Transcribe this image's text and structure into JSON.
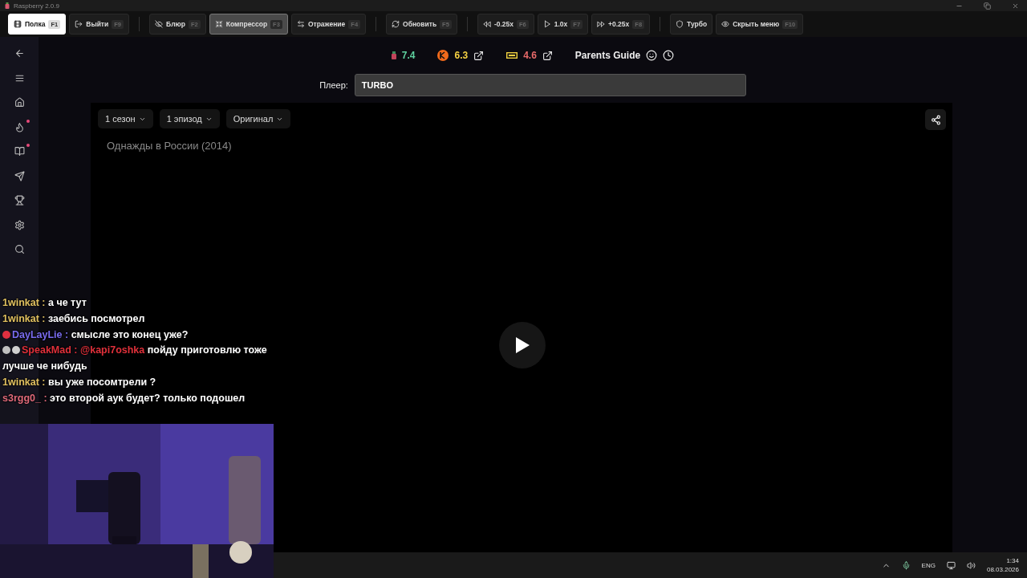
{
  "window": {
    "title": "Raspberry 2.0.9"
  },
  "toolbar": [
    [
      {
        "label": "Полка",
        "key": "F1",
        "selected": true,
        "on": false
      },
      {
        "label": "Выйти",
        "key": "F9",
        "selected": false,
        "on": false
      }
    ],
    [
      {
        "label": "Блюр",
        "key": "F2",
        "selected": false,
        "on": false
      },
      {
        "label": "Компрессор",
        "key": "F3",
        "selected": false,
        "on": true
      },
      {
        "label": "Отражение",
        "key": "F4",
        "selected": false,
        "on": false
      }
    ],
    [
      {
        "label": "Обновить",
        "key": "F5",
        "selected": false,
        "on": false
      }
    ],
    [
      {
        "label": "-0.25x",
        "key": "F6",
        "selected": false,
        "on": false
      },
      {
        "label": "1.0x",
        "key": "F7",
        "selected": false,
        "on": false
      },
      {
        "label": "+0.25x",
        "key": "F8",
        "selected": false,
        "on": false
      }
    ],
    [
      {
        "label": "Турбо",
        "selected": false,
        "on": false
      },
      {
        "label": "Скрыть меню",
        "key": "F10",
        "selected": false,
        "on": false
      }
    ]
  ],
  "sidebar": {
    "items": [
      {
        "dot": false
      },
      {
        "dot": false
      },
      {
        "dot": false
      },
      {
        "dot": true
      },
      {
        "dot": true
      },
      {
        "dot": false
      },
      {
        "dot": false
      },
      {
        "dot": false
      },
      {
        "dot": false
      }
    ]
  },
  "ratings": [
    {
      "value": "7.4",
      "color": "#5fd3a0",
      "link": false
    },
    {
      "value": "6.3",
      "color": "#f5d142",
      "link": true
    },
    {
      "value": "4.6",
      "color": "#e86a6a",
      "link": true
    }
  ],
  "parents_guide": "Parents Guide",
  "player": {
    "label": "Плеер:",
    "value": "TURBO"
  },
  "video": {
    "title": "Однажды в России (2014)",
    "dropdowns": [
      "1 сезон",
      "1 эпизод",
      "Оригинал"
    ]
  },
  "chat": [
    {
      "user": "1winkat",
      "separator": ":",
      "color": "#e0c060",
      "text": "а че тут"
    },
    {
      "user": "1winkat",
      "separator": ":",
      "color": "#e0c060",
      "text": "заебись посмотрел"
    },
    {
      "user": "DayLayLie",
      "separator": ":",
      "color": "#7a6cf0",
      "badges": [
        {
          "color": "#e03040"
        }
      ],
      "text": "смысле это конец уже?"
    },
    {
      "user": "SpeakMad",
      "separator": ":",
      "color": "#e0303a",
      "badges": [
        {
          "color": "#c0c0c0"
        },
        {
          "color": "#d0d0d0"
        }
      ],
      "mention": "@kapi7oshka",
      "text": "пойду приготовлю тоже лучше че нибудь"
    },
    {
      "user": "1winkat",
      "separator": ":",
      "color": "#e0c060",
      "text": "вы уже посомтрели ?"
    },
    {
      "user": "s3rgg0_",
      "separator": ":",
      "color": "#e06a7a",
      "text": "это второй аук будет? только подошел"
    }
  ],
  "webcam": {
    "kind": "picture"
  },
  "taskbar": {
    "language": "ENG",
    "time": "1:34",
    "date": "08.03.2026"
  }
}
